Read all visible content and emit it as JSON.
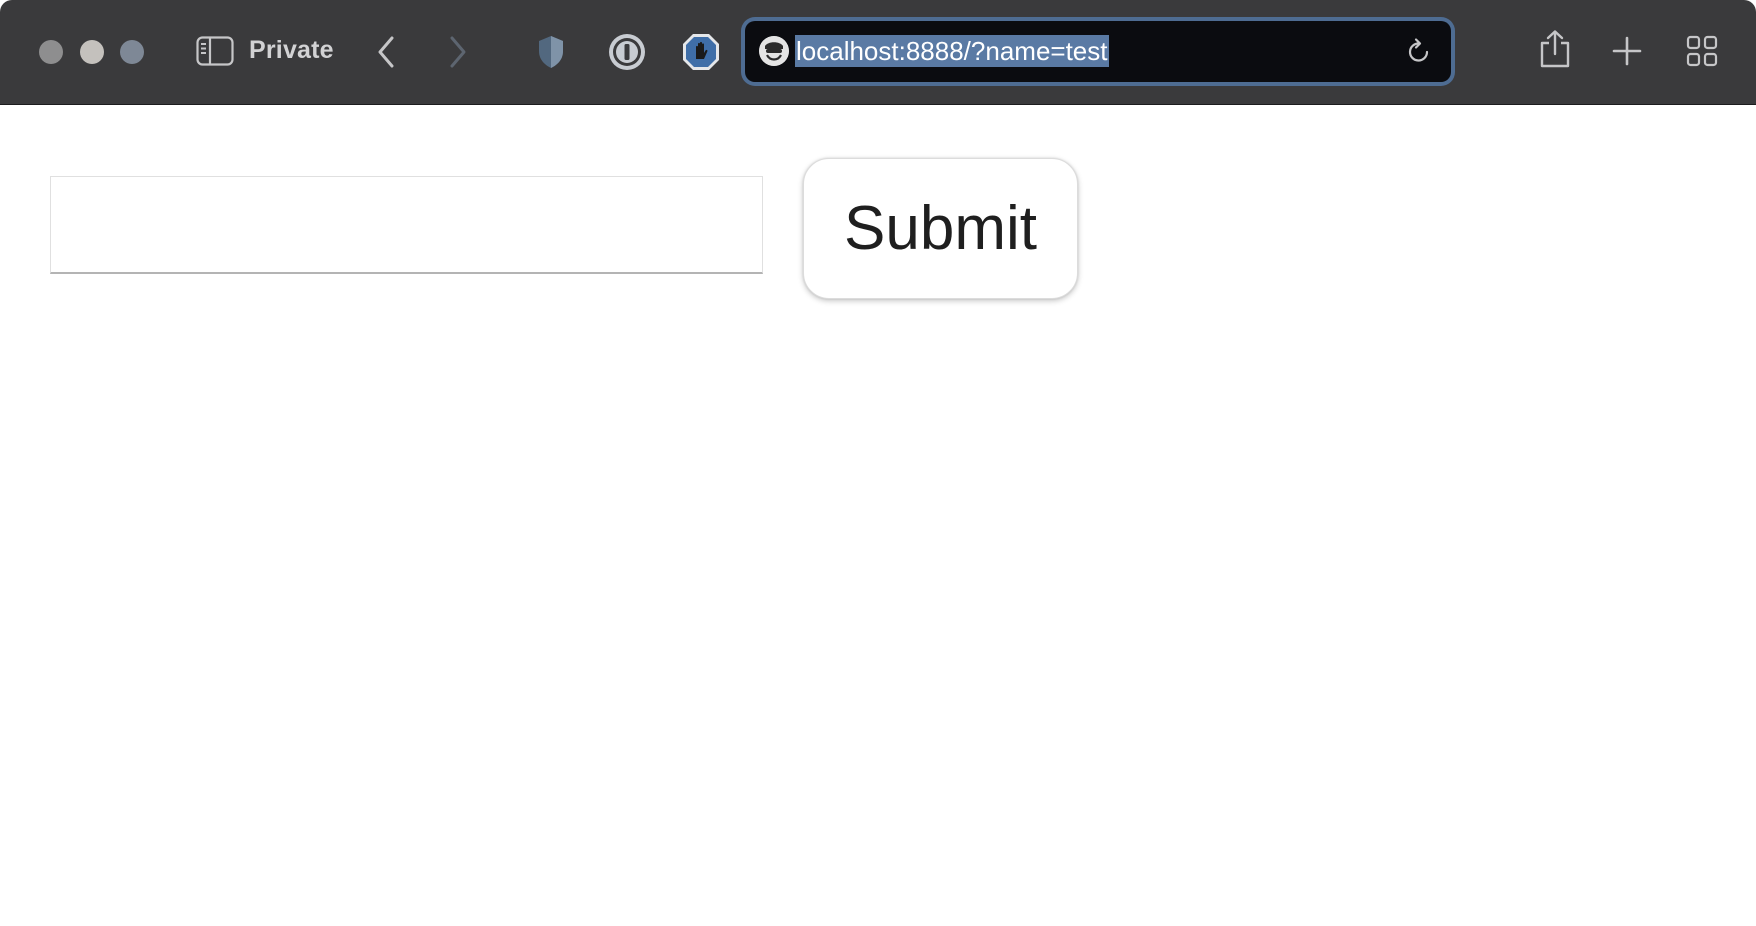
{
  "browser": {
    "mode_label": "Private",
    "address_bar": {
      "url": "localhost:8888/?name=test",
      "selected": true
    },
    "colors": {
      "toolbar": "#3a3a3c",
      "address_focus_ring": "#4e6c92",
      "url_selection": "#5a7aa4"
    },
    "icons": [
      "sidebar-icon",
      "back-chevron-icon",
      "forward-chevron-icon",
      "shield-extension-icon",
      "password-manager-icon",
      "adblock-hand-icon",
      "site-favicon",
      "reload-icon",
      "share-icon",
      "new-tab-plus-icon",
      "tab-overview-grid-icon"
    ]
  },
  "page": {
    "name_input": {
      "value": "",
      "placeholder": ""
    },
    "submit_label": "Submit"
  }
}
